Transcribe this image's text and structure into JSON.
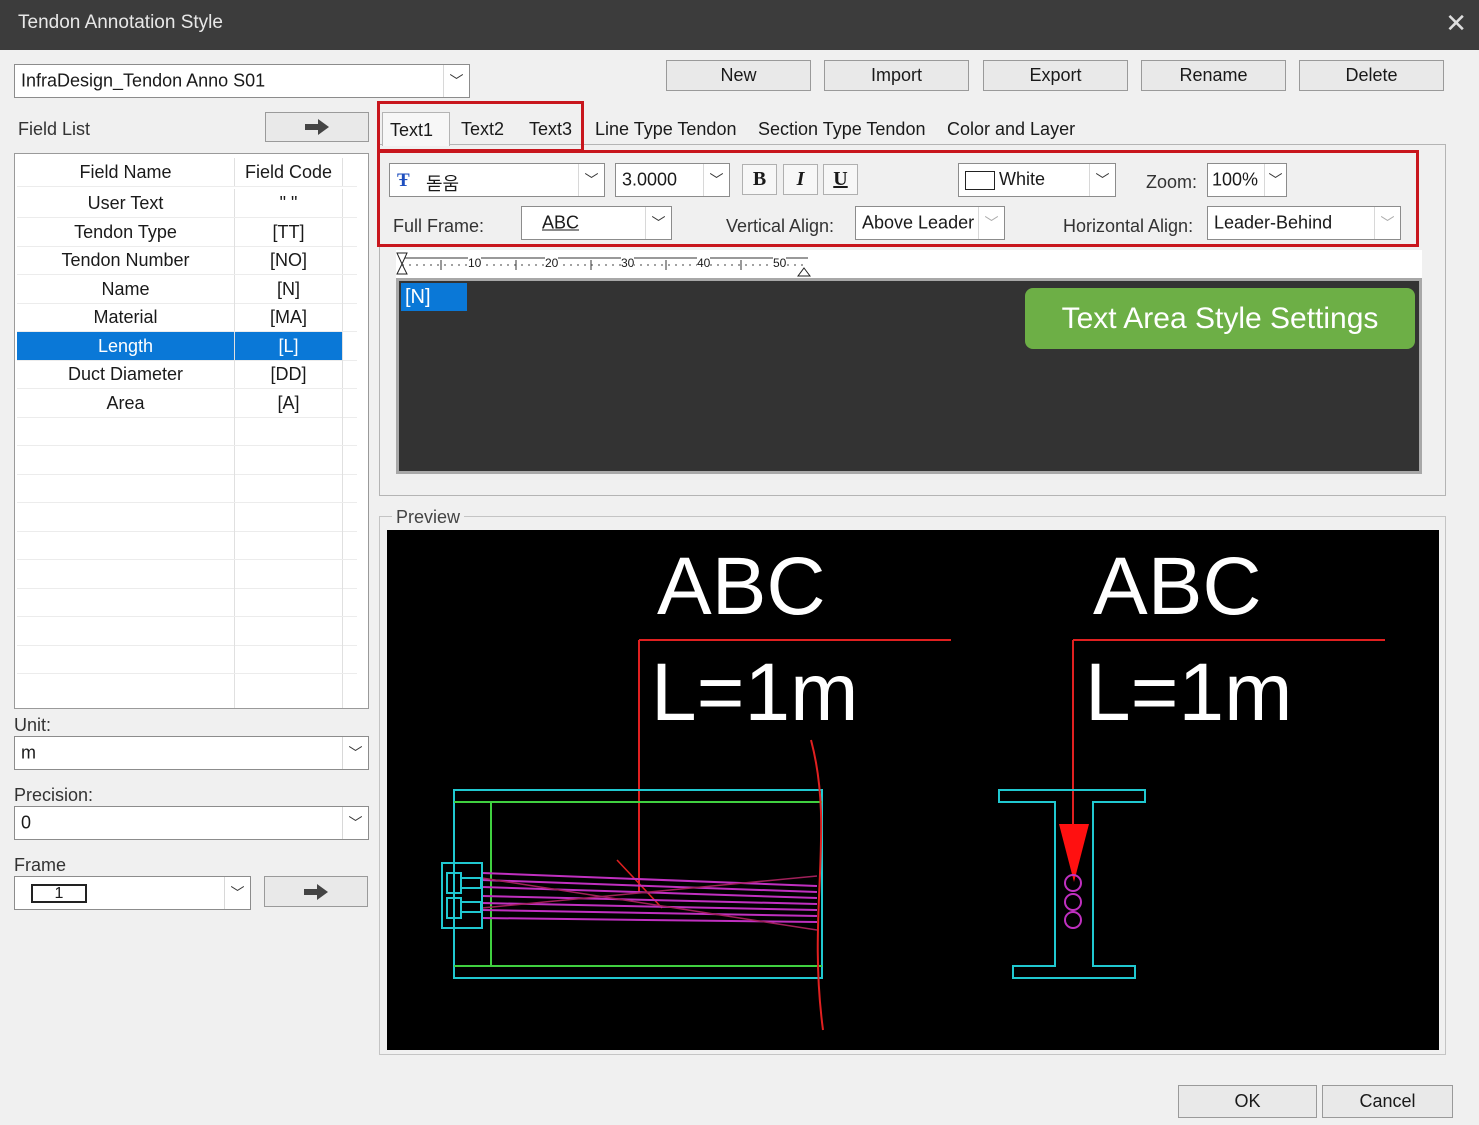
{
  "window": {
    "title": "Tendon Annotation Style",
    "close_glyph": "✕"
  },
  "style_select": {
    "value": "InfraDesign_Tendon Anno S01"
  },
  "toolbar": {
    "new": "New",
    "import": "Import",
    "export": "Export",
    "rename": "Rename",
    "delete": "Delete"
  },
  "field_list": {
    "label": "Field List",
    "headers": {
      "name": "Field Name",
      "code": "Field Code"
    },
    "rows": [
      {
        "name": "User Text",
        "code": "\" \""
      },
      {
        "name": "Tendon Type",
        "code": "[TT]"
      },
      {
        "name": "Tendon Number",
        "code": "[NO]"
      },
      {
        "name": "Name",
        "code": "[N]"
      },
      {
        "name": "Material",
        "code": "[MA]"
      },
      {
        "name": "Length",
        "code": "[L]"
      },
      {
        "name": "Duct Diameter",
        "code": "[DD]"
      },
      {
        "name": "Area",
        "code": "[A]"
      }
    ],
    "selected_index": 5
  },
  "unit": {
    "label": "Unit:",
    "value": "m"
  },
  "precision": {
    "label": "Precision:",
    "value": "0"
  },
  "frame": {
    "label": "Frame",
    "value": "1"
  },
  "tabs": [
    "Text1",
    "Text2",
    "Text3",
    "Line Type Tendon",
    "Section Type Tendon",
    "Color and Layer"
  ],
  "active_tab": "Text1",
  "text_style": {
    "font": "돋움",
    "size": "3.0000",
    "bold": "B",
    "italic": "I",
    "underline": "U",
    "color": "White",
    "zoom_label": "Zoom:",
    "zoom": "100%",
    "full_frame_label": "Full Frame:",
    "full_frame": "ABC",
    "vertical_align_label": "Vertical Align:",
    "vertical_align": "Above Leader",
    "horizontal_align_label": "Horizontal Align:",
    "horizontal_align": "Leader-Behind"
  },
  "ruler_labels": [
    "10",
    "20",
    "30",
    "40",
    "50"
  ],
  "editor_text": "[N]",
  "callout": "Text Area Style Settings",
  "preview": {
    "label": "Preview",
    "left_top": "ABC",
    "left_bottom": "L=1m",
    "right_top": "ABC",
    "right_bottom": "L=1m"
  },
  "footer": {
    "ok": "OK",
    "cancel": "Cancel"
  },
  "colors": {
    "accent_red": "#c8161d",
    "selection": "#0a78d7",
    "callout_green": "#6daf46"
  }
}
